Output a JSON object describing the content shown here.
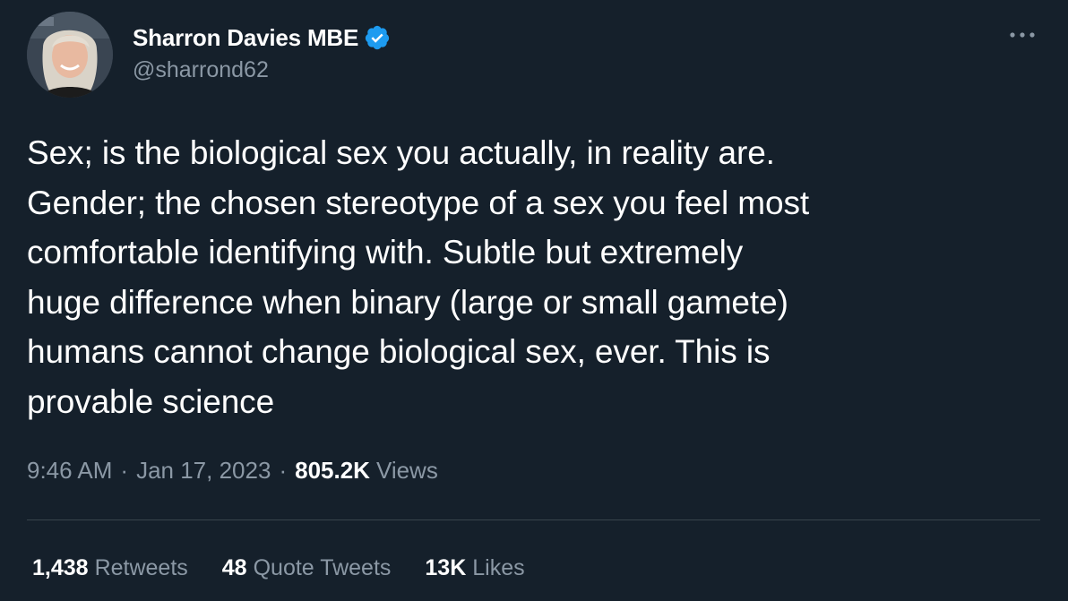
{
  "author": {
    "display_name": "Sharron Davies MBE",
    "handle": "@sharrond62",
    "verified_icon": "verified-badge-icon",
    "avatar_icon": "profile-photo"
  },
  "tweet": {
    "text": "Sex; is the biological sex you actually, in reality are.\nGender; the chosen stereotype of a sex you feel most\ncomfortable identifying with. Subtle but extremely\nhuge difference when binary (large or small gamete)\nhumans cannot change biological sex, ever. This is\nprovable science",
    "time": "9:46 AM",
    "separator": "·",
    "date": "Jan 17, 2023",
    "views_count": "805.2K",
    "views_label": "Views"
  },
  "stats": [
    {
      "count": "1,438",
      "label": "Retweets"
    },
    {
      "count": "48",
      "label": "Quote Tweets"
    },
    {
      "count": "13K",
      "label": "Likes"
    }
  ],
  "menu": {
    "more_icon": "more-options-icon"
  },
  "colors": {
    "background": "#15202b",
    "primary_text": "#ffffff",
    "secondary_text": "#8b98a5",
    "verified_blue": "#1d9bf0",
    "divider": "#38444d"
  }
}
